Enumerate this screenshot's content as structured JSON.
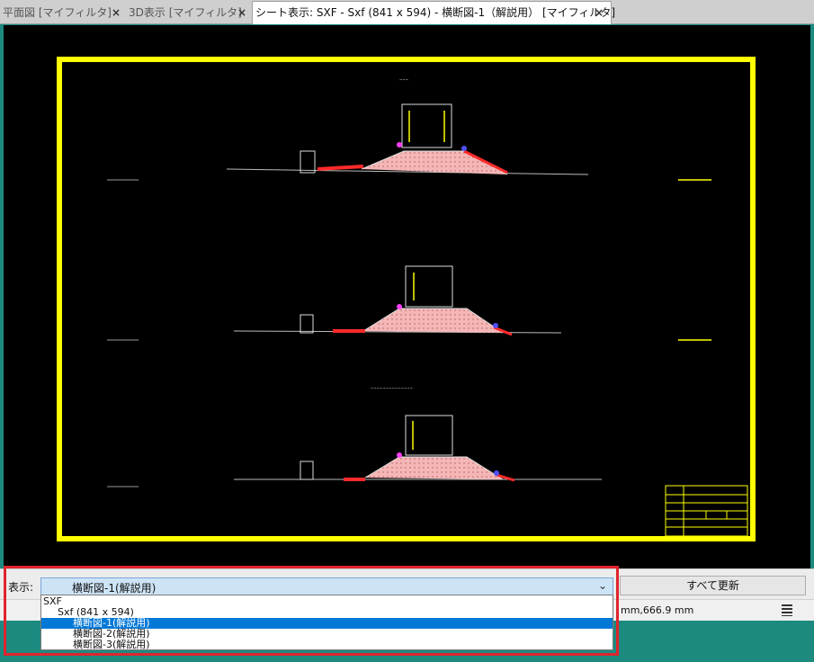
{
  "tabs": [
    {
      "label": "平面図 [マイフィルタ]",
      "close": "×",
      "active": false
    },
    {
      "label": "3D表示 [マイフィルタ]",
      "close": "×",
      "active": false
    },
    {
      "label": "シート表示: SXF - Sxf (841 x 594) - 横断図-1（解説用） [マイフィルタ]",
      "close": "×",
      "active": true
    }
  ],
  "toolbar": {
    "display_label": "表示:",
    "selected_view": "横断図-1(解説用)",
    "update_all_label": "すべて更新"
  },
  "status": {
    "coordinate": "mm,666.9 mm"
  },
  "dropdown": {
    "items": [
      {
        "label": "SXF",
        "level": 0,
        "selected": false
      },
      {
        "label": "Sxf (841 x 594)",
        "level": 1,
        "selected": false
      },
      {
        "label": "横断図-1(解説用)",
        "level": 2,
        "selected": true
      },
      {
        "label": "横断図-2(解説用)",
        "level": 2,
        "selected": false
      },
      {
        "label": "横断図-3(解説用)",
        "level": 2,
        "selected": false
      }
    ]
  },
  "colors": {
    "sheet_frame": "#ffff00",
    "fill_earth": "#f4b6b6",
    "lining": "#ff2a2a",
    "accent": "#0078d7",
    "highlight": "#e0242c",
    "background": "#1d8a80"
  },
  "icons": {
    "tab_close": "close-icon",
    "dropdown_arrow": "chevron-down-icon",
    "status_grip": "grip-icon"
  }
}
